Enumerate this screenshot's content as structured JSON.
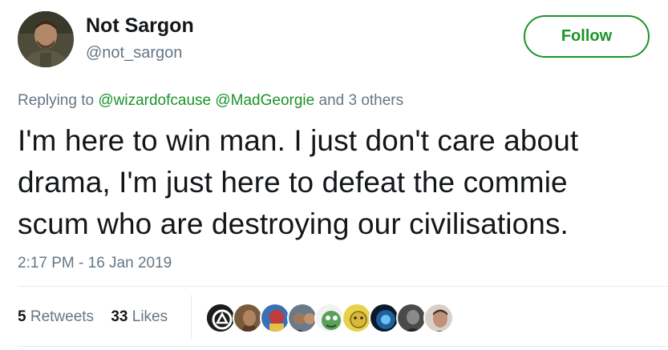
{
  "user": {
    "display_name": "Not Sargon",
    "handle": "@not_sargon",
    "avatar_icon": "user-avatar-photo"
  },
  "follow_button": {
    "label": "Follow",
    "color": "#1b9427"
  },
  "replying": {
    "prefix": "Replying to",
    "mentions": [
      "@wizardofcause",
      "@MadGeorgie"
    ],
    "suffix": "and 3 others"
  },
  "tweet": {
    "lines": [
      "I'm here to win man. I just don't care about",
      "drama, I'm just here to defeat the commie",
      "scum who are destroying our civilisations."
    ]
  },
  "timestamp": "2:17 PM - 16 Jan 2019",
  "stats": {
    "retweets": {
      "count": "5",
      "label": "Retweets"
    },
    "likes": {
      "count": "33",
      "label": "Likes"
    }
  },
  "likers": [
    {
      "name": "liker-avatar-1",
      "color": "#1c1c1c"
    },
    {
      "name": "liker-avatar-2",
      "color": "#7a5a3c"
    },
    {
      "name": "liker-avatar-3",
      "color": "#c23b3b"
    },
    {
      "name": "liker-avatar-4",
      "color": "#3a3a3a"
    },
    {
      "name": "liker-avatar-5",
      "color": "#5aa05a"
    },
    {
      "name": "liker-avatar-6",
      "color": "#d8c24a"
    },
    {
      "name": "liker-avatar-7",
      "color": "#1f5f9a"
    },
    {
      "name": "liker-avatar-8",
      "color": "#4a4a4a"
    },
    {
      "name": "liker-avatar-9",
      "color": "#a07860"
    }
  ]
}
